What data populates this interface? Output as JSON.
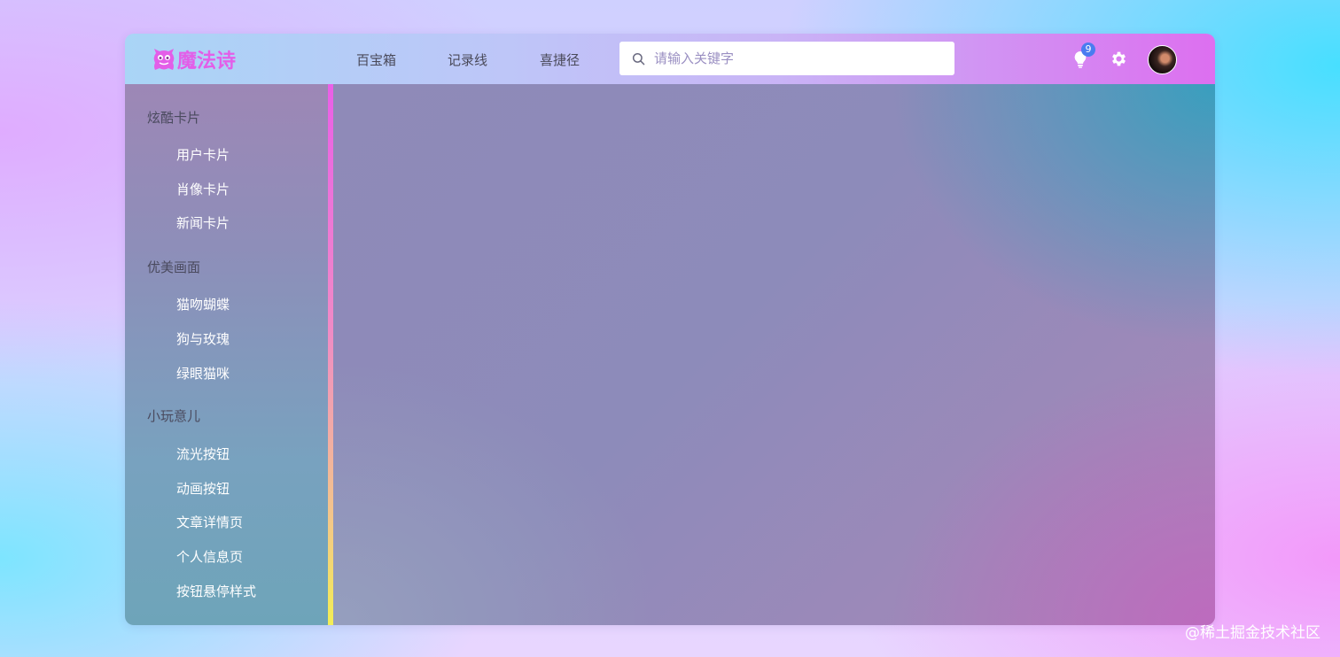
{
  "app": {
    "logo_text": "魔法诗",
    "logo_icon": "monster-icon"
  },
  "header": {
    "nav": [
      "百宝箱",
      "记录线",
      "喜捷径"
    ],
    "search": {
      "placeholder": "请输入关键字",
      "value": ""
    },
    "notification_count": "9",
    "icons": [
      "bulb-icon",
      "gear-icon"
    ]
  },
  "sidebar": {
    "groups": [
      {
        "title": "炫酷卡片",
        "items": [
          "用户卡片",
          "肖像卡片",
          "新闻卡片"
        ]
      },
      {
        "title": "优美画面",
        "items": [
          "猫吻蝴蝶",
          "狗与玫瑰",
          "绿眼猫咪"
        ]
      },
      {
        "title": "小玩意儿",
        "items": [
          "流光按钮",
          "动画按钮",
          "文章详情页",
          "个人信息页",
          "按钮悬停样式"
        ]
      }
    ]
  },
  "watermark": "@稀土掘金技术社区",
  "colors": {
    "logo": "#e35ee8",
    "badge": "#4a7cf0",
    "sidebar_border_top": "#ea5fe8",
    "sidebar_border_bottom": "#f3ee55"
  }
}
